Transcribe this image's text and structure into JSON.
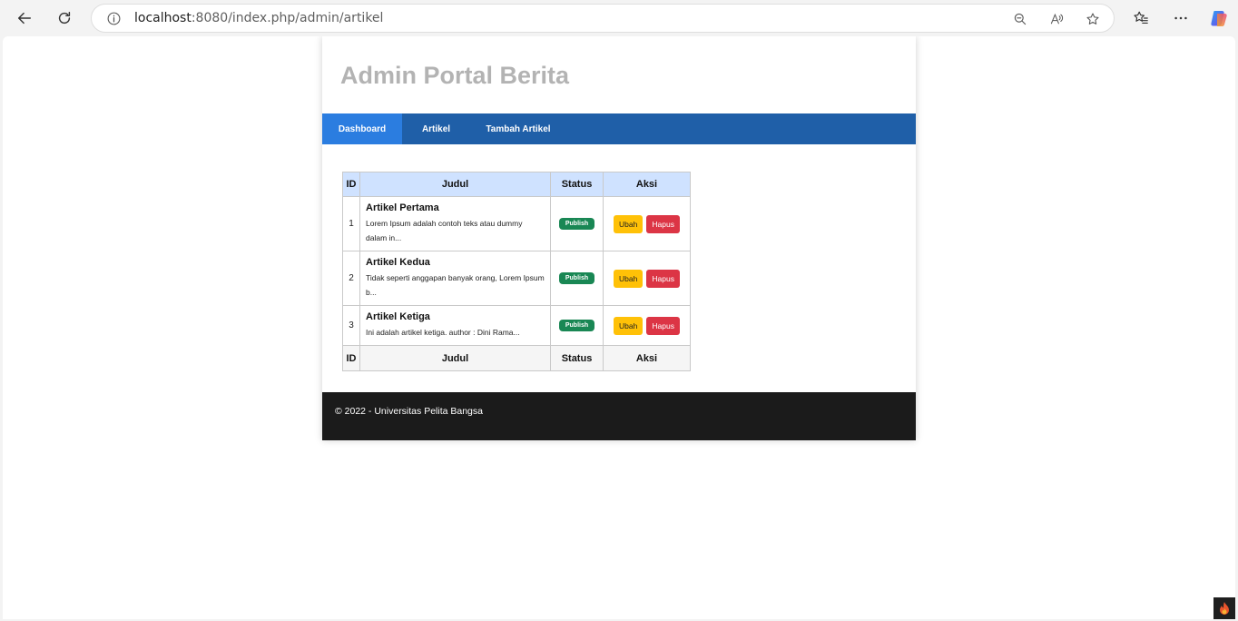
{
  "browser": {
    "url_host": "localhost",
    "url_rest": ":8080/index.php/admin/artikel"
  },
  "page": {
    "title": "Admin Portal Berita",
    "nav": [
      {
        "label": "Dashboard",
        "active": true
      },
      {
        "label": "Artikel",
        "active": false
      },
      {
        "label": "Tambah Artikel",
        "active": false
      }
    ]
  },
  "table": {
    "headers": [
      "ID",
      "Judul",
      "Status",
      "Aksi"
    ],
    "rows": [
      {
        "id": "1",
        "title": "Artikel Pertama",
        "desc": "Lorem Ipsum adalah contoh teks atau dummy dalam in...",
        "status": "Publish",
        "edit": "Ubah",
        "delete": "Hapus"
      },
      {
        "id": "2",
        "title": "Artikel Kedua",
        "desc": "Tidak seperti anggapan banyak orang, Lorem Ipsum b...",
        "status": "Publish",
        "edit": "Ubah",
        "delete": "Hapus"
      },
      {
        "id": "3",
        "title": "Artikel Ketiga",
        "desc": "Ini adalah artikel ketiga. author : Dini Rama...",
        "status": "Publish",
        "edit": "Ubah",
        "delete": "Hapus"
      }
    ],
    "footers": [
      "ID",
      "Judul",
      "Status",
      "Aksi"
    ]
  },
  "footer": {
    "text": "© 2022 - Universitas Pelita Bangsa"
  },
  "colors": {
    "navbar": "#1f5fa8",
    "nav_active": "#2b7de0",
    "badge": "#198754",
    "btn_warning": "#ffc107",
    "btn_danger": "#dc3545",
    "footer_bg": "#1b1b1b",
    "title": "#b3b3b3"
  }
}
